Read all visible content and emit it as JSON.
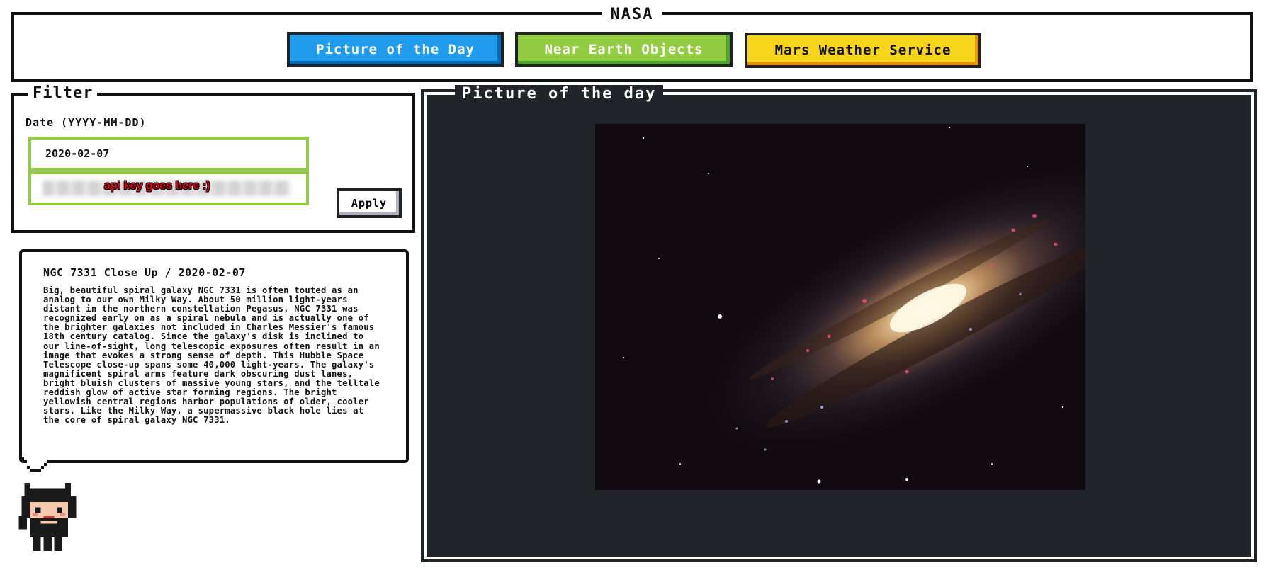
{
  "header": {
    "title": "NASA",
    "nav": [
      {
        "label": "Picture of the Day",
        "color": "#209cee"
      },
      {
        "label": "Near Earth Objects",
        "color": "#92cc41"
      },
      {
        "label": "Mars Weather Service",
        "color": "#f7d51d"
      }
    ]
  },
  "filter": {
    "title": "Filter",
    "date_label": "Date (YYYY-MM-DD)",
    "date_value": "2020-02-07",
    "api_key_hint": "api key goes here :)",
    "apply_label": "Apply"
  },
  "apod": {
    "heading": "NGC 7331 Close Up / 2020-02-07",
    "explanation": "Big, beautiful spiral galaxy NGC 7331 is often touted as an analog to our own Milky Way. About 50 million light-years distant in the northern constellation Pegasus, NGC 7331 was recognized early on as a spiral nebula and is actually one of the brighter galaxies not included in Charles Messier's famous 18th century catalog. Since the galaxy's disk is inclined to our line-of-sight, long telescopic exposures often result in an image that evokes a strong sense of depth. This Hubble Space Telescope close-up spans some 40,000 light-years. The galaxy's magnificent spiral arms feature dark obscuring dust lanes, bright bluish clusters of massive young stars, and the telltale reddish glow of active star forming regions. The bright yellowish central regions harbor populations of older, cooler stars. Like the Milky Way, a supermassive black hole lies at the core of spiral galaxy NGC 7331."
  },
  "picture": {
    "title": "Picture of the day",
    "image_icon": "spiral-galaxy-photo"
  },
  "mascot": {
    "icon": "octocat-icon"
  }
}
